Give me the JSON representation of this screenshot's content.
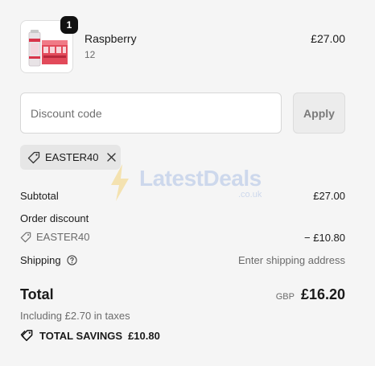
{
  "product": {
    "name": "Raspberry",
    "variant": "12",
    "price": "£27.00",
    "quantity": "1",
    "image_icon": "drink-can-multipack-icon"
  },
  "discount": {
    "placeholder": "Discount code",
    "apply_label": "Apply",
    "applied_code": "EASTER40"
  },
  "watermark": {
    "brand": "LatestDeals",
    "domain": ".co.uk"
  },
  "summary": {
    "subtotal_label": "Subtotal",
    "subtotal_value": "£27.00",
    "order_discount_label": "Order discount",
    "discount_code": "EASTER40",
    "discount_value": "− £10.80",
    "shipping_label": "Shipping",
    "shipping_value": "Enter shipping address",
    "total_label": "Total",
    "currency": "GBP",
    "total_value": "£16.20",
    "taxes_note": "Including £2.70 in taxes",
    "savings_label": "TOTAL SAVINGS",
    "savings_value": "£10.80"
  },
  "colors": {
    "background": "#f5f5f5",
    "chip_bg": "#e6e6e6",
    "text": "#1a1a1a",
    "muted": "#6b6b6b"
  }
}
